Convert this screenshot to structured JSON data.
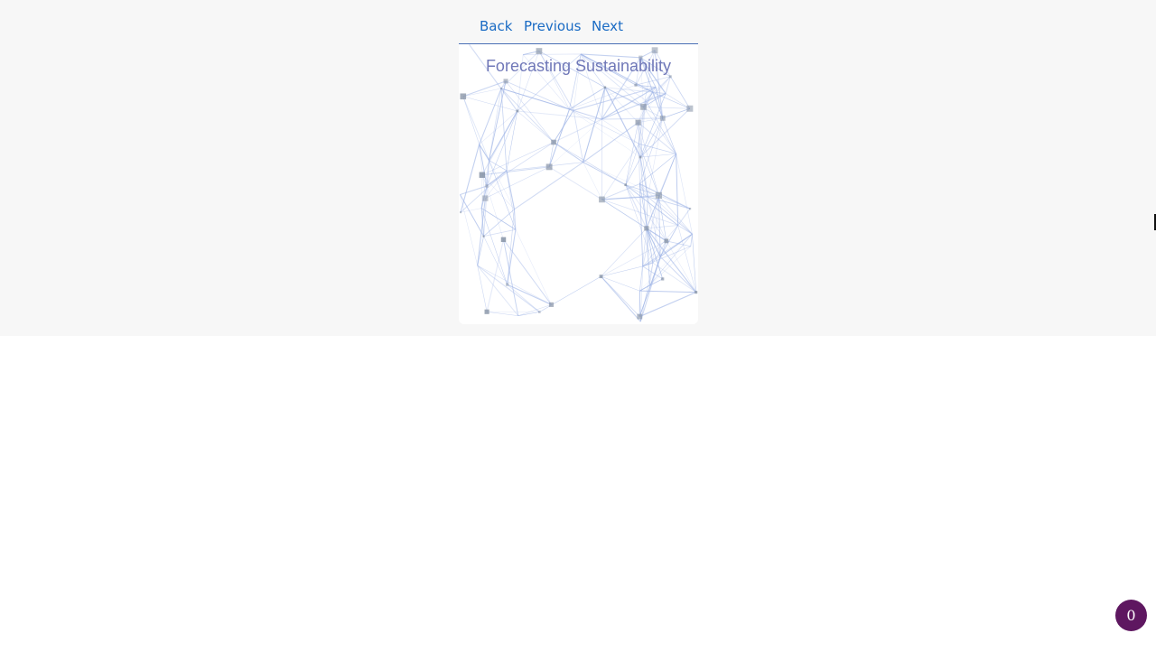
{
  "nav": {
    "back_label": "Back",
    "previous_label": "Previous",
    "next_label": "Next"
  },
  "cover": {
    "title": "Forecasting Sustainability",
    "art": "network-graph"
  },
  "badge": {
    "count": "0"
  },
  "colors": {
    "link": "#1a6bc4",
    "panel_background": "#f7f7f7",
    "cover_title": "#7078b8",
    "network_lines": "#9db3e6",
    "network_nodes": "#8a96a8",
    "badge_background": "#5e1760"
  }
}
